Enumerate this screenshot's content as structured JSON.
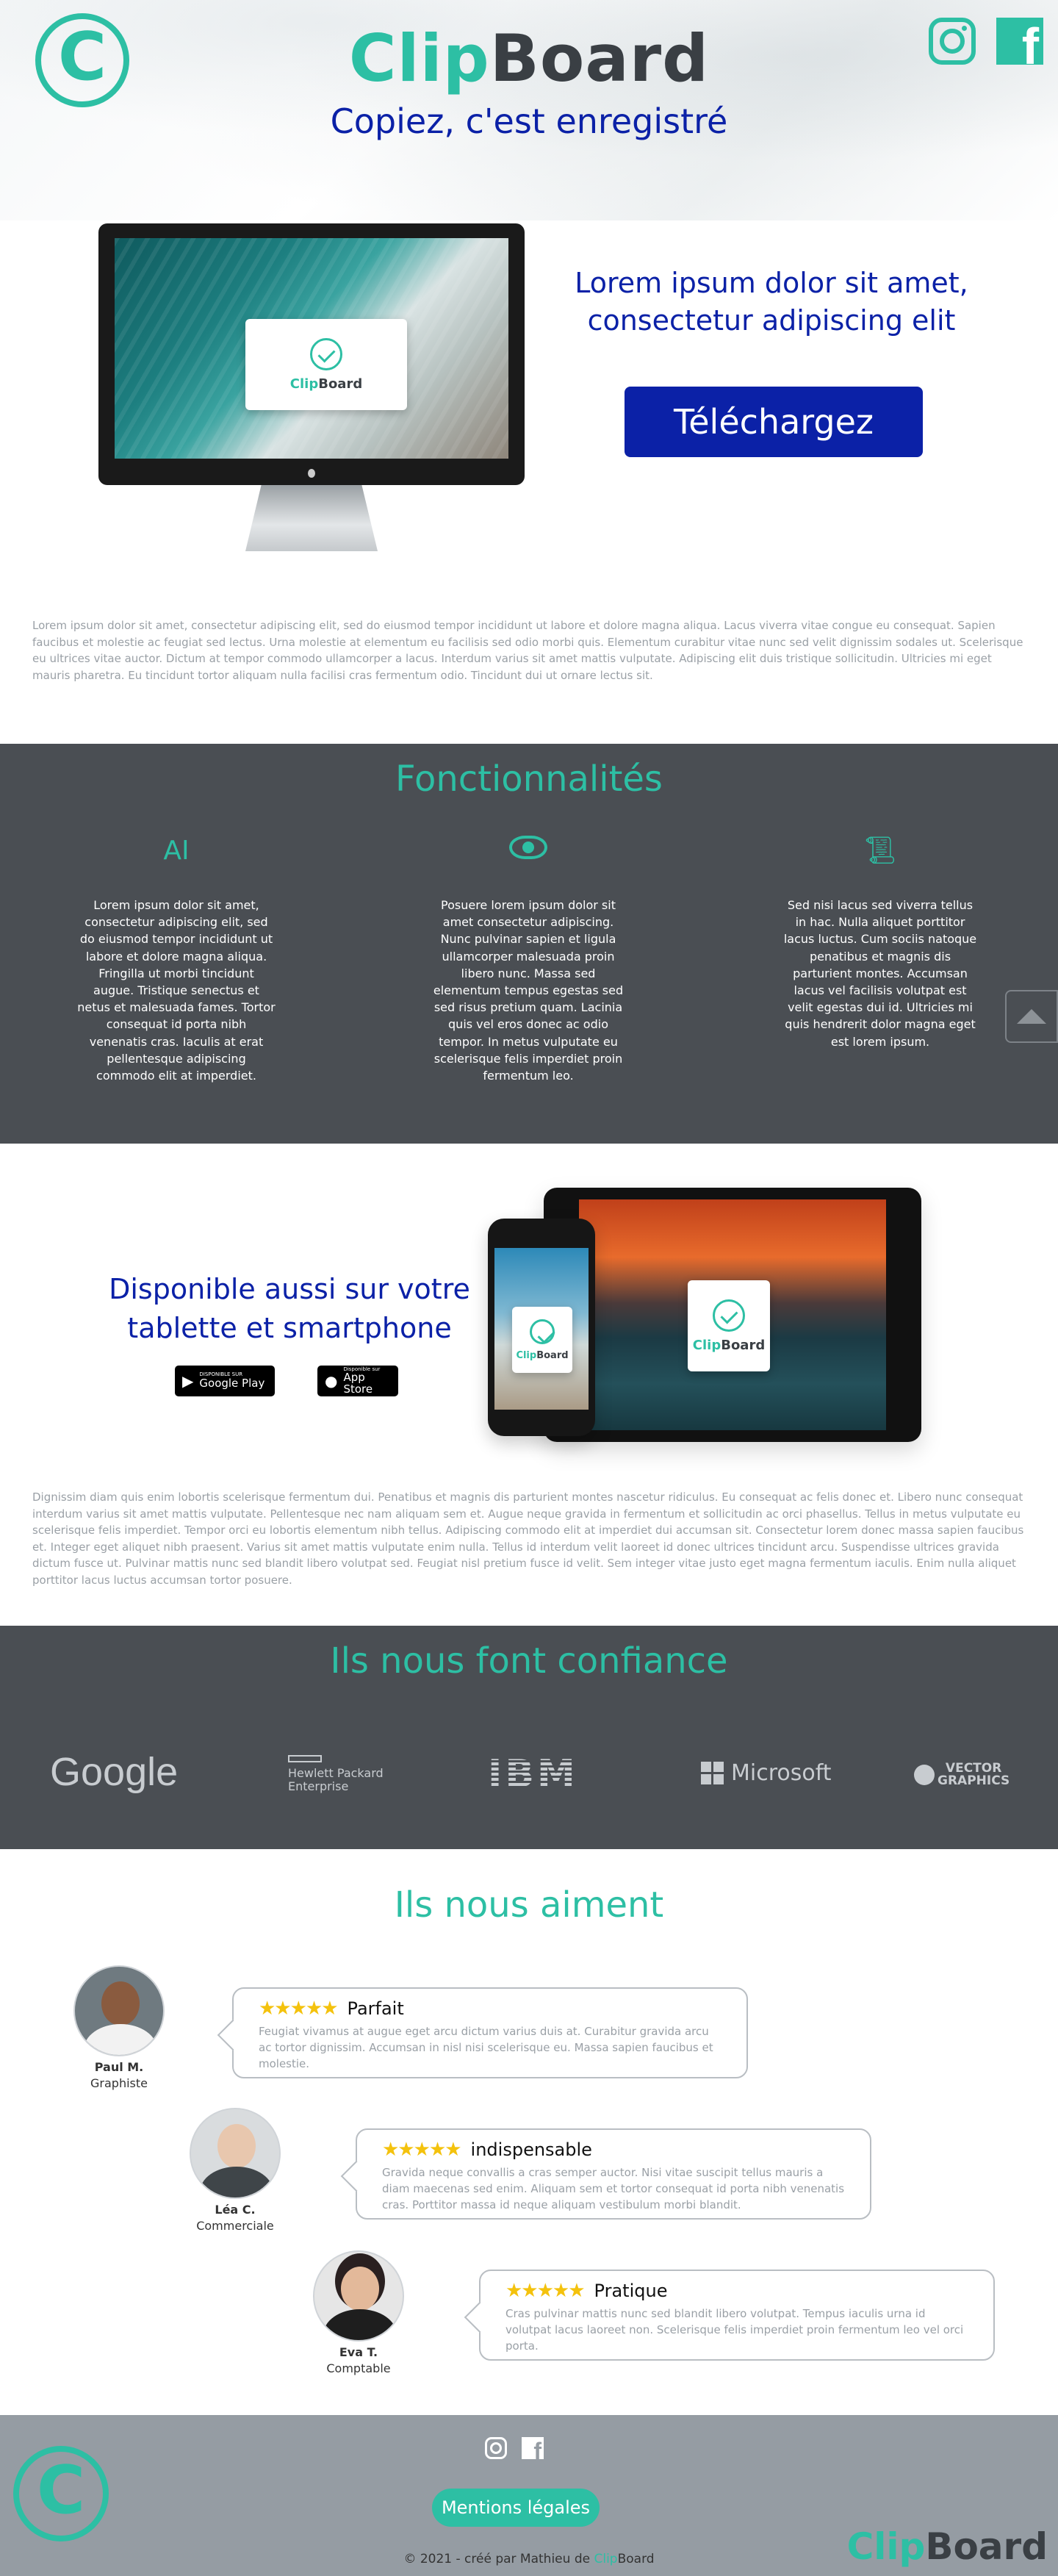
{
  "header": {
    "logo_symbol": "C",
    "brand_part1": "Clip",
    "brand_part2": "Board",
    "tagline": "Copiez, c'est enregistré",
    "social": [
      "instagram-icon",
      "facebook-icon"
    ]
  },
  "intro": {
    "headline": "Lorem ipsum dolor sit amet, consectetur adipiscing elit",
    "download_label": "Téléchargez",
    "card_brand_part1": "Clip",
    "card_brand_part2": "Board",
    "paragraph": "Lorem ipsum dolor sit amet, consectetur adipiscing elit, sed do eiusmod tempor incididunt ut labore et dolore magna aliqua. Lacus viverra vitae congue eu consequat. Sapien faucibus et molestie ac feugiat sed lectus. Urna molestie at elementum eu facilisis sed odio morbi quis. Elementum curabitur vitae nunc sed velit dignissim sodales ut. Scelerisque eu ultrices vitae auctor. Dictum at tempor commodo ullamcorper a lacus. Interdum varius sit amet mattis vulputate. Adipiscing elit duis tristique sollicitudin. Ultricies mi eget mauris pharetra. Eu tincidunt tortor aliquam nulla facilisi cras fermentum odio. Tincidunt dui ut ornare lectus sit."
  },
  "features": {
    "title": "Fonctionnalités",
    "items": [
      {
        "icon": "text-recognition-icon",
        "text": "Lorem ipsum dolor sit amet, consectetur adipiscing elit, sed do eiusmod tempor incididunt ut labore et dolore magna aliqua. Fringilla ut morbi tincidunt augue. Tristique senectus et netus et malesuada fames. Tortor consequat id porta nibh venenatis cras. Iaculis at erat pellentesque adipiscing commodo elit at imperdiet."
      },
      {
        "icon": "eye-icon",
        "text": "Posuere lorem ipsum dolor sit amet consectetur adipiscing. Nunc pulvinar sapien et ligula ullamcorper malesuada proin libero nunc. Massa sed elementum tempus egestas sed sed risus pretium quam. Lacinia quis vel eros donec ac odio tempor. In metus vulputate eu scelerisque felis imperdiet proin fermentum leo."
      },
      {
        "icon": "scroll-icon",
        "text": "Sed nisi lacus sed viverra tellus in hac. Nulla aliquet porttitor lacus luctus. Cum sociis natoque penatibus et magnis dis parturient montes. Accumsan lacus vel facilisis volutpat est velit egestas dui id. Ultricies mi quis hendrerit dolor magna eget est lorem ipsum."
      }
    ]
  },
  "available": {
    "headline": "Disponible aussi sur votre tablette et smartphone",
    "google_play_small": "DISPONIBLE SUR",
    "google_play_big": "Google Play",
    "app_store_small": "Disponible sur",
    "app_store_big": "App Store",
    "paragraph": "Dignissim diam quis enim lobortis scelerisque fermentum dui. Penatibus et magnis dis parturient montes nascetur ridiculus. Eu consequat ac felis donec et. Libero nunc consequat interdum varius sit amet mattis vulputate. Pellentesque nec nam aliquam sem et. Augue neque gravida in fermentum et sollicitudin ac orci phasellus. Tellus in metus vulputate eu scelerisque felis imperdiet. Tempor orci eu lobortis elementum nibh tellus. Adipiscing commodo elit at imperdiet dui accumsan sit. Consectetur lorem donec massa sapien faucibus et. Integer eget aliquet nibh praesent. Varius sit amet mattis vulputate enim nulla. Tellus id interdum velit laoreet id donec ultrices tincidunt arcu. Suspendisse ultrices gravida dictum fusce ut. Pulvinar mattis nunc sed blandit libero volutpat sed. Feugiat nisl pretium fusce id velit. Sem integer vitae justo eget magna fermentum iaculis. Enim nulla aliquet porttitor lacus luctus accumsan tortor posuere."
  },
  "trust": {
    "title": "Ils nous font confiance",
    "partners": {
      "google": "Google",
      "hp_line1": "Hewlett Packard",
      "hp_line2": "Enterprise",
      "ibm": "IBM",
      "microsoft": "Microsoft",
      "vg_line1": "VECTOR",
      "vg_line2": "GRAPHICS"
    }
  },
  "reviews": {
    "title": "Ils nous aiment",
    "items": [
      {
        "name": "Paul M.",
        "role": "Graphiste",
        "stars": "★★★★★",
        "title": "Parfait",
        "text": "Feugiat vivamus at augue eget arcu dictum varius duis at. Curabitur gravida arcu ac tortor dignissim. Accumsan in nisl nisi scelerisque eu. Massa sapien faucibus et molestie."
      },
      {
        "name": "Léa C.",
        "role": "Commerciale",
        "stars": "★★★★★",
        "title": "indispensable",
        "text": "Gravida neque convallis a cras semper auctor. Nisi vitae suscipit tellus mauris a diam maecenas sed enim. Aliquam sem et tortor consequat id porta nibh venenatis cras. Porttitor massa id neque aliquam vestibulum morbi blandit."
      },
      {
        "name": "Eva T.",
        "role": "Comptable",
        "stars": "★★★★★",
        "title": "Pratique",
        "text": "Cras pulvinar mattis nunc sed blandit libero volutpat. Tempus iaculis urna id volutpat lacus laoreet non. Scelerisque felis imperdiet proin fermentum leo vel orci porta."
      }
    ]
  },
  "footer": {
    "legal_label": "Mentions légales",
    "credit_prefix": "© 2021 - créé par Mathieu de ",
    "brand_part1": "Clip",
    "brand_part2": "Board"
  },
  "colors": {
    "accent": "#2dbfa4",
    "primary": "#0b21a7",
    "dark": "#4a4e53",
    "footer": "#959ca3"
  }
}
